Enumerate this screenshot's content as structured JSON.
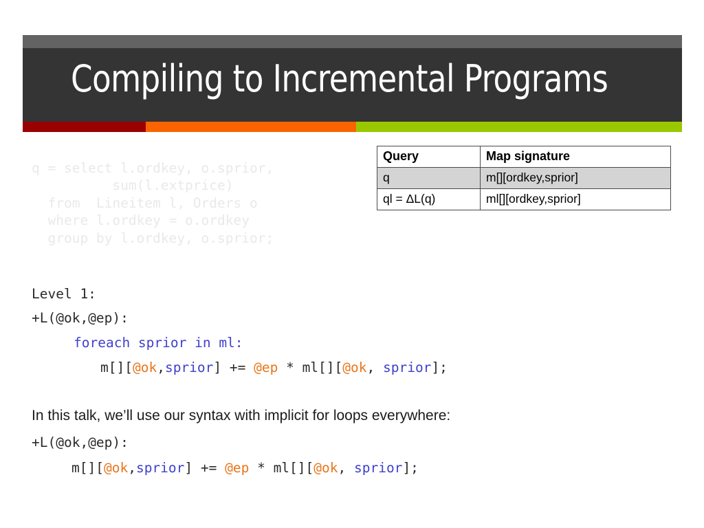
{
  "slide": {
    "title": "Compiling to Incremental Programs",
    "accent_colors": {
      "banner_top": "#636363",
      "banner_body": "#343434",
      "red": "#990000",
      "orange": "#fa6400",
      "green": "#9ac800"
    }
  },
  "sql_block": {
    "text": "q = select l.ordkey, o.sprior,\n          sum(l.extprice)\n  from  Lineitem l, Orders o\n  where l.ordkey = o.ordkey\n  group by l.ordkey, o.sprior;",
    "color": "#e9e9e9"
  },
  "map_table": {
    "headers": [
      "Query",
      "Map signature"
    ],
    "rows": [
      {
        "query": "q",
        "signature": "m[][ordkey,sprior]",
        "shaded": true
      },
      {
        "query": "ql = ΔL(q)",
        "signature": "ml[][ordkey,sprior]",
        "shaded": false
      }
    ]
  },
  "code": {
    "level_label": "Level 1:",
    "trigger_1": "+L(@ok,@ep):",
    "foreach_line": "foreach sprior in ml:",
    "assign_1": {
      "t1": "m[][",
      "t2": "@ok",
      "t3": ",",
      "t4": "sprior",
      "t5": "] += ",
      "t6": "@ep",
      "t7": " * ml[][",
      "t8": "@ok",
      "t9": ", ",
      "t10": "sprior",
      "t11": "];"
    },
    "trigger_2": "+L(@ok,@ep):",
    "assign_2": {
      "t1": "m[][",
      "t2": "@ok",
      "t3": ",",
      "t4": "sprior",
      "t5": "] += ",
      "t6": "@ep",
      "t7": " * ml[][",
      "t8": "@ok",
      "t9": ", ",
      "t10": "sprior",
      "t11": "];"
    },
    "colors": {
      "keyword": "#4040cc",
      "at_variable": "#e8761b",
      "plain": "#2a2a2a"
    }
  },
  "prose": {
    "intro": "In this talk, we’ll use our syntax with implicit for loops everywhere:"
  }
}
